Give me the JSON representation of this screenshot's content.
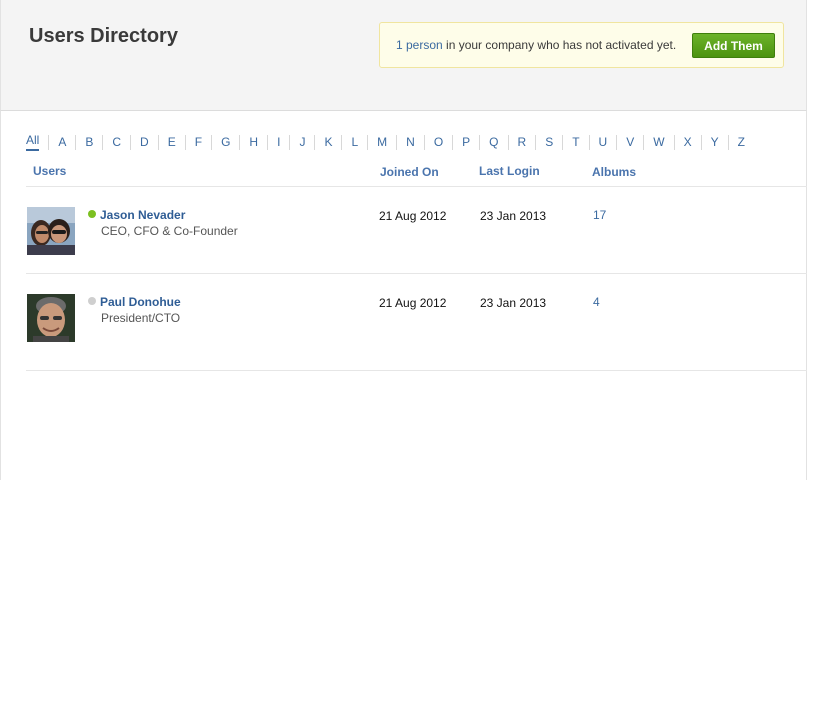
{
  "header": {
    "title": "Users Directory",
    "notice": {
      "link_text": "1 person",
      "text": " in your company who has not activated yet.",
      "button_label": "Add Them"
    }
  },
  "alphabet": [
    "All",
    "A",
    "B",
    "C",
    "D",
    "E",
    "F",
    "G",
    "H",
    "I",
    "J",
    "K",
    "L",
    "M",
    "N",
    "O",
    "P",
    "Q",
    "R",
    "S",
    "T",
    "U",
    "V",
    "W",
    "X",
    "Y",
    "Z"
  ],
  "alphabet_active": "All",
  "columns": {
    "users": "Users",
    "joined": "Joined On",
    "last_login": "Last Login",
    "albums": "Albums"
  },
  "users": [
    {
      "name": "Jason Nevader",
      "title": "CEO, CFO & Co-Founder",
      "status": "online",
      "joined": "21 Aug 2012",
      "last_login": "23 Jan 2013",
      "albums": "17"
    },
    {
      "name": "Paul Donohue",
      "title": "President/CTO",
      "status": "offline",
      "joined": "21 Aug 2012",
      "last_login": "23 Jan 2013",
      "albums": "4"
    }
  ],
  "colors": {
    "online": "#7cc021",
    "offline": "#cfcfcf",
    "link": "#3b6aa0",
    "button": "#5aa21c"
  }
}
